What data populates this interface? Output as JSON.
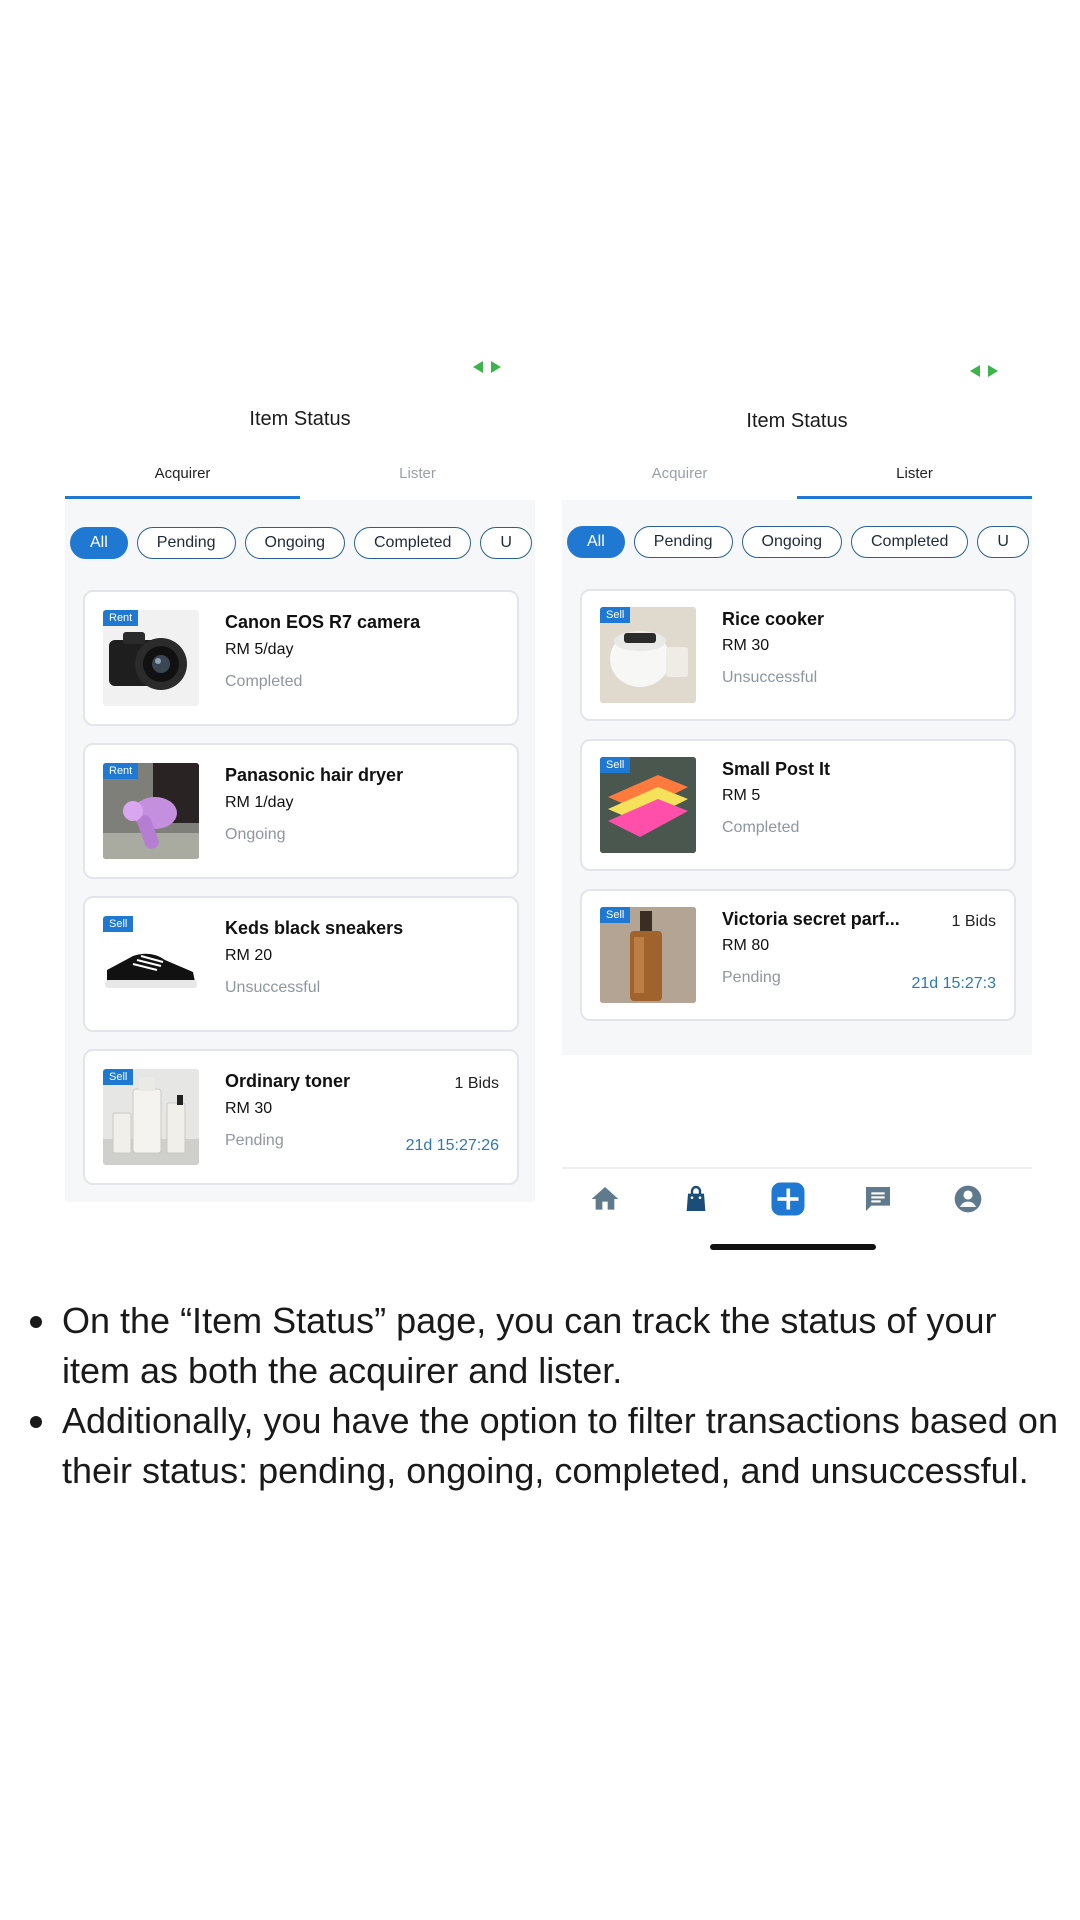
{
  "left_screen": {
    "title": "Item Status",
    "tabs": [
      {
        "label": "Acquirer",
        "active": true
      },
      {
        "label": "Lister",
        "active": false
      }
    ],
    "filters": [
      "All",
      "Pending",
      "Ongoing",
      "Completed",
      "U"
    ],
    "items": [
      {
        "badge": "Rent",
        "name": "Canon EOS R7 camera",
        "price": "RM 5/day",
        "status": "Completed",
        "thumb": "camera"
      },
      {
        "badge": "Rent",
        "name": "Panasonic hair dryer",
        "price": "RM 1/day",
        "status": "Ongoing",
        "thumb": "hair-dryer"
      },
      {
        "badge": "Sell",
        "name": "Keds black sneakers",
        "price": "RM 20",
        "status": "Unsuccessful",
        "thumb": "sneakers"
      },
      {
        "badge": "Sell",
        "name": "Ordinary toner",
        "price": "RM 30",
        "status": "Pending",
        "bids": "1 Bids",
        "timer": "21d 15:27:26",
        "thumb": "toner"
      }
    ]
  },
  "right_screen": {
    "title": "Item Status",
    "tabs": [
      {
        "label": "Acquirer",
        "active": false
      },
      {
        "label": "Lister",
        "active": true
      }
    ],
    "filters": [
      "All",
      "Pending",
      "Ongoing",
      "Completed",
      "U"
    ],
    "items": [
      {
        "badge": "Sell",
        "name": "Rice cooker",
        "price": "RM 30",
        "status": "Unsuccessful",
        "thumb": "rice-cooker"
      },
      {
        "badge": "Sell",
        "name": "Small Post It",
        "price": "RM 5",
        "status": "Completed",
        "thumb": "post-it"
      },
      {
        "badge": "Sell",
        "name": "Victoria secret parf...",
        "price": "RM 80",
        "status": "Pending",
        "bids": "1 Bids",
        "timer": "21d 15:27:3",
        "thumb": "perfume"
      }
    ],
    "nav_icons": [
      "home-icon",
      "shopping-bag-icon",
      "add-icon",
      "chat-icon",
      "account-icon"
    ]
  },
  "colors": {
    "accent": "#1f78d1",
    "timer": "#2c78b7",
    "status_gray": "#8e969e",
    "signal": "#3bb54a"
  },
  "bullets": [
    "On the “Item Status” page, you can track the status of your item as both the acquirer and lister.",
    "Additionally, you have the option to filter transactions based on their status: pending, ongoing, completed, and unsuccessful."
  ]
}
